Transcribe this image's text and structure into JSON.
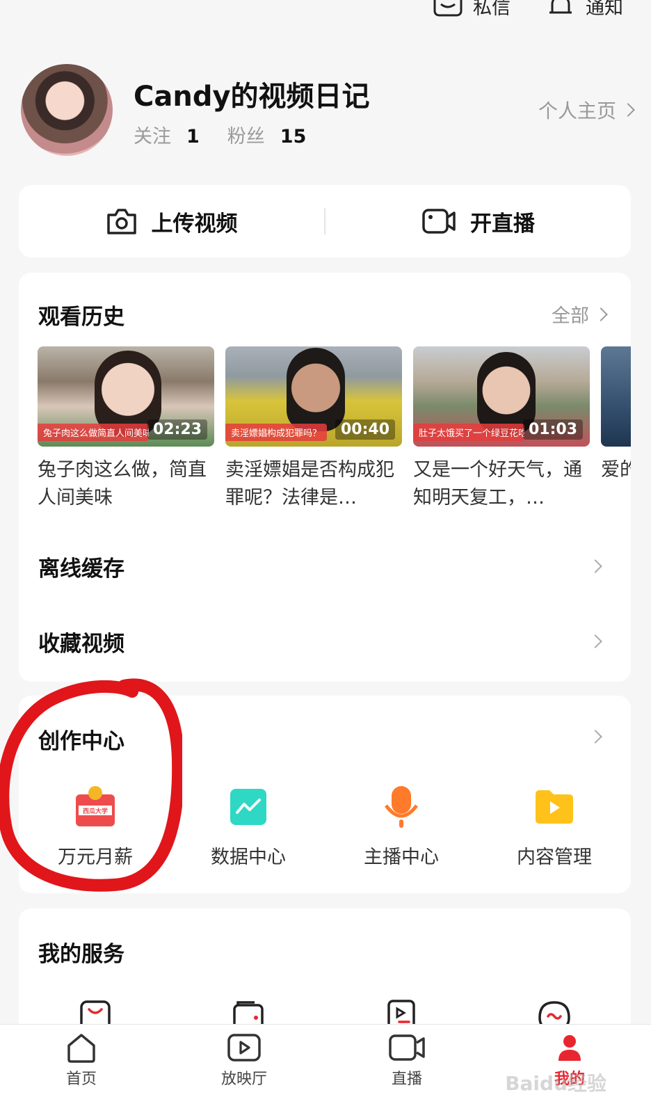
{
  "topbar": {
    "messages_label": "私信",
    "notifications_label": "通知"
  },
  "profile": {
    "username": "Candy的视频日记",
    "following_label": "关注",
    "following_count": "1",
    "fans_label": "粉丝",
    "fans_count": "15",
    "homepage_label": "个人主页"
  },
  "actions": {
    "upload_label": "上传视频",
    "live_label": "开直播"
  },
  "history": {
    "title": "观看历史",
    "all_label": "全部",
    "items": [
      {
        "title": "兔子肉这么做，简直人间美味",
        "duration": "02:23",
        "caption": "兔子肉这么做简直人间美味"
      },
      {
        "title": "卖淫嫖娼是否构成犯罪呢？法律是…",
        "duration": "00:40",
        "caption": "卖淫嫖娼构成犯罪吗？"
      },
      {
        "title": "又是一个好天气，通知明天复工，…",
        "duration": "01:03",
        "caption": "肚子太饿买了一个绿豆花吃"
      },
      {
        "title": "爱的x飞",
        "duration": "",
        "caption": ""
      }
    ]
  },
  "menu": {
    "offline_label": "离线缓存",
    "favorites_label": "收藏视频"
  },
  "creator": {
    "title": "创作中心",
    "items": [
      {
        "label": "万元月薪",
        "badge": "西瓜大学"
      },
      {
        "label": "数据中心"
      },
      {
        "label": "主播中心"
      },
      {
        "label": "内容管理"
      }
    ]
  },
  "services": {
    "title": "我的服务"
  },
  "tabbar": {
    "items": [
      {
        "label": "首页"
      },
      {
        "label": "放映厅"
      },
      {
        "label": "直播"
      },
      {
        "label": "我的"
      }
    ]
  },
  "watermark": "Baidu经验",
  "colors": {
    "accent": "#e8262f",
    "annotation": "#e0161b",
    "data_icon": "#2fd7c5",
    "anchor_icon": "#ff7a2a",
    "content_icon": "#ffc21a"
  }
}
